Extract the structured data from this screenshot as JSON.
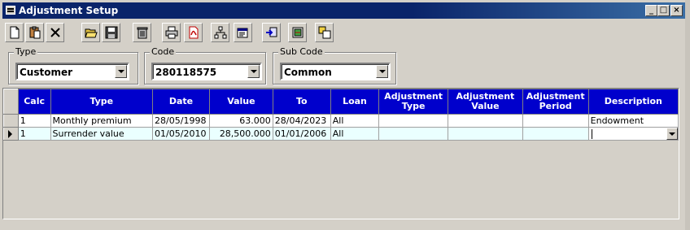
{
  "window": {
    "title": "Adjustment Setup",
    "controls": {
      "minimize": "_",
      "maximize": "□",
      "close": "×"
    }
  },
  "toolbar": {
    "buttons": [
      "new-icon",
      "paste-icon",
      "delete-x-icon",
      "open-folder-icon",
      "save-icon",
      "trash-icon",
      "print-icon",
      "pdf-icon",
      "hierarchy-icon",
      "properties-icon",
      "import-arrow-icon",
      "export-icon",
      "copy-records-icon"
    ]
  },
  "filters": {
    "type": {
      "label": "Type",
      "value": "Customer"
    },
    "code": {
      "label": "Code",
      "value": "280118575"
    },
    "subcode": {
      "label": "Sub Code",
      "value": "Common"
    }
  },
  "grid": {
    "columns": [
      "Calc",
      "Type",
      "Date",
      "Value",
      "To",
      "Loan",
      "Adjustment Type",
      "Adjustment Value",
      "Adjustment Period",
      "Description"
    ],
    "rows": [
      {
        "calc": "1",
        "type": "Monthly premium",
        "date": "28/05/1998",
        "value": "63.000",
        "to": "28/04/2023",
        "loan": "All",
        "adj_type": "",
        "adj_value": "",
        "adj_period": "",
        "description": "Endowment"
      },
      {
        "calc": "1",
        "type": "Surrender value",
        "date": "01/05/2010",
        "value": "28,500.000",
        "to": "01/01/2006",
        "loan": "All",
        "adj_type": "",
        "adj_value": "",
        "adj_period": "",
        "description": ""
      }
    ]
  },
  "colors": {
    "header_bg": "#0000cc",
    "titlebar": "#0a246a",
    "current_row": "#eaffff",
    "window_bg": "#d4d0c8"
  }
}
